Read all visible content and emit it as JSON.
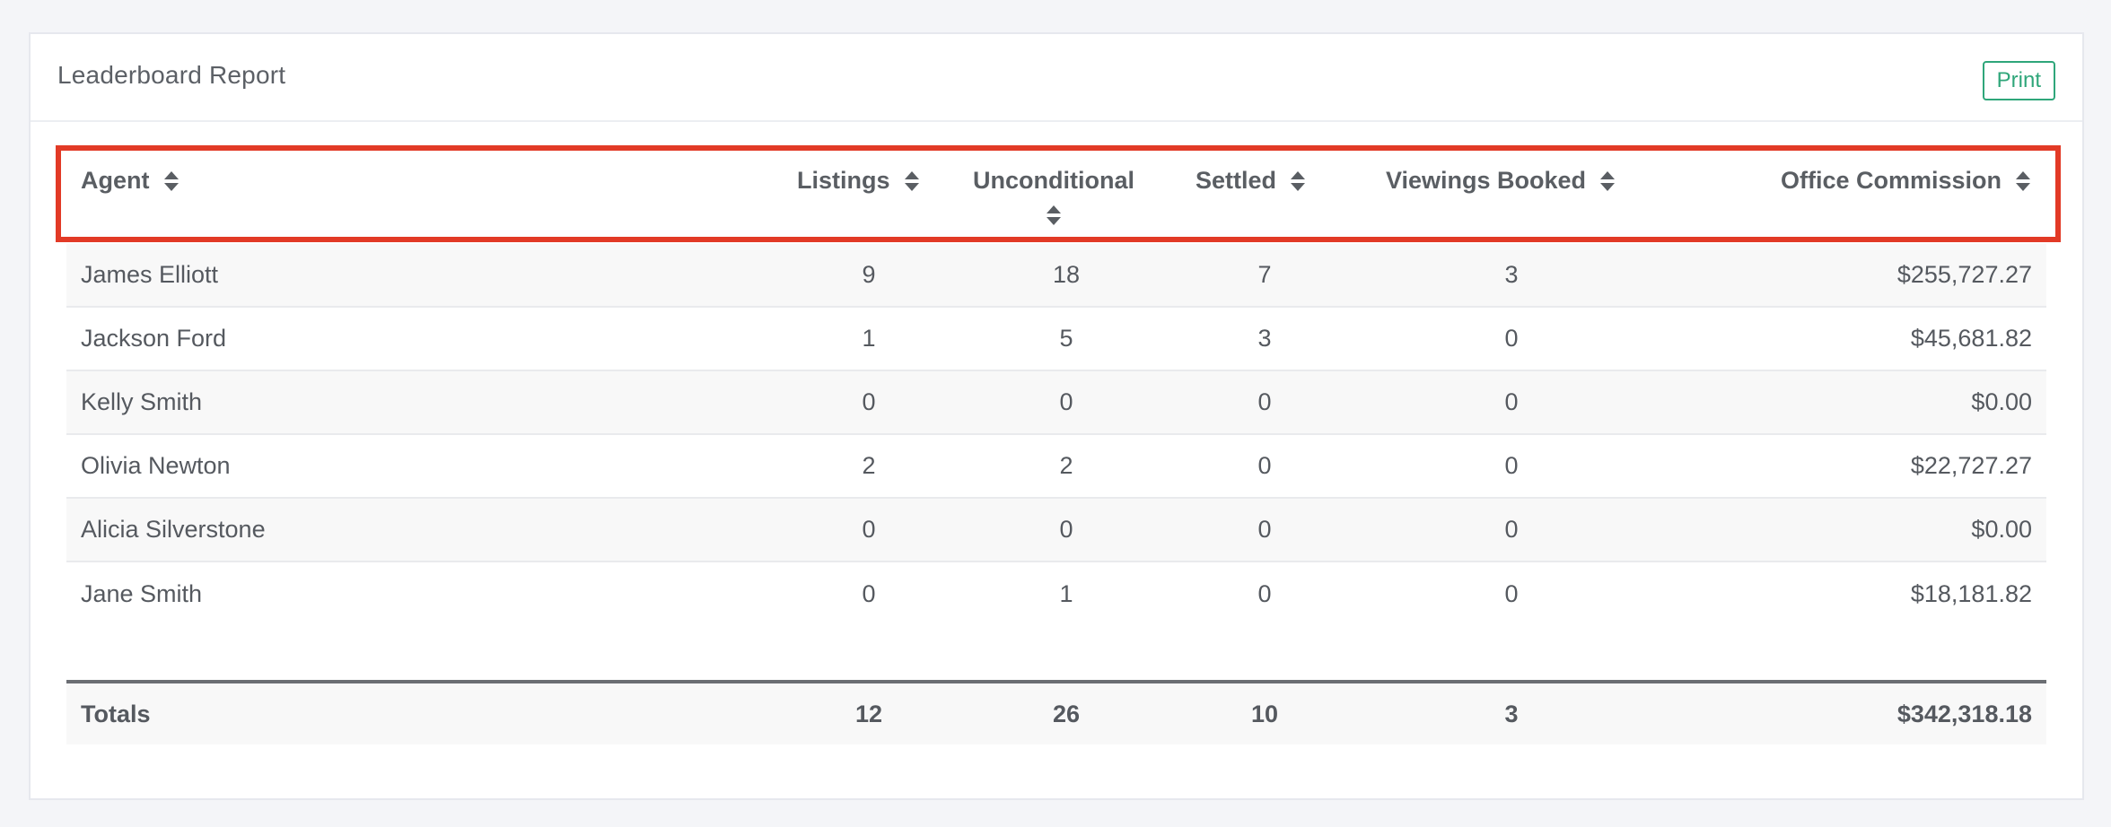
{
  "report": {
    "title": "Leaderboard Report",
    "print_label": "Print"
  },
  "table": {
    "headers": {
      "agent": "Agent",
      "listings": "Listings",
      "unconditional": "Unconditional",
      "settled": "Settled",
      "viewings": "Viewings Booked",
      "commission": "Office Commission"
    },
    "rows": [
      {
        "agent": "James Elliott",
        "listings": "9",
        "unconditional": "18",
        "settled": "7",
        "viewings": "3",
        "commission": "$255,727.27"
      },
      {
        "agent": "Jackson Ford",
        "listings": "1",
        "unconditional": "5",
        "settled": "3",
        "viewings": "0",
        "commission": "$45,681.82"
      },
      {
        "agent": "Kelly Smith",
        "listings": "0",
        "unconditional": "0",
        "settled": "0",
        "viewings": "0",
        "commission": "$0.00"
      },
      {
        "agent": "Olivia Newton",
        "listings": "2",
        "unconditional": "2",
        "settled": "0",
        "viewings": "0",
        "commission": "$22,727.27"
      },
      {
        "agent": "Alicia Silverstone",
        "listings": "0",
        "unconditional": "0",
        "settled": "0",
        "viewings": "0",
        "commission": "$0.00"
      },
      {
        "agent": "Jane Smith",
        "listings": "0",
        "unconditional": "1",
        "settled": "0",
        "viewings": "0",
        "commission": "$18,181.82"
      }
    ],
    "totals": {
      "agent": "Totals",
      "listings": "12",
      "unconditional": "26",
      "settled": "10",
      "viewings": "3",
      "commission": "$342,318.18"
    }
  },
  "colors": {
    "highlight": "#e23a26",
    "print_accent": "#2fa67a"
  }
}
